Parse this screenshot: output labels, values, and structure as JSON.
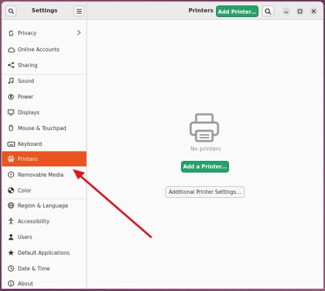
{
  "window": {
    "title": "Settings",
    "panel_title": "Printers",
    "add_printer_header": "Add Printer…"
  },
  "sidebar": {
    "items": [
      {
        "label": "Privacy",
        "icon": "hand-icon"
      },
      {
        "label": "Online Accounts",
        "icon": "cloud-icon"
      },
      {
        "label": "Sharing",
        "icon": "share-icon"
      },
      {
        "label": "Sound",
        "icon": "music-note-icon"
      },
      {
        "label": "Power",
        "icon": "power-icon"
      },
      {
        "label": "Displays",
        "icon": "monitor-icon"
      },
      {
        "label": "Mouse & Touchpad",
        "icon": "mouse-icon"
      },
      {
        "label": "Keyboard",
        "icon": "keyboard-icon"
      },
      {
        "label": "Printers",
        "icon": "printer-icon"
      },
      {
        "label": "Removable Media",
        "icon": "media-icon"
      },
      {
        "label": "Color",
        "icon": "color-icon"
      },
      {
        "label": "Region & Language",
        "icon": "globe-icon"
      },
      {
        "label": "Accessibility",
        "icon": "accessibility-icon"
      },
      {
        "label": "Users",
        "icon": "users-icon"
      },
      {
        "label": "Default Applications",
        "icon": "star-icon"
      },
      {
        "label": "Date & Time",
        "icon": "clock-icon"
      },
      {
        "label": "About",
        "icon": "info-icon"
      }
    ]
  },
  "main": {
    "empty_text": "No printers",
    "add_printer_button": "Add a Printer…",
    "additional_settings_button": "Additional Printer Settings…"
  },
  "colors": {
    "accent": "#e95420",
    "primary_button": "#26a269",
    "annotation_arrow": "#e3141c"
  }
}
